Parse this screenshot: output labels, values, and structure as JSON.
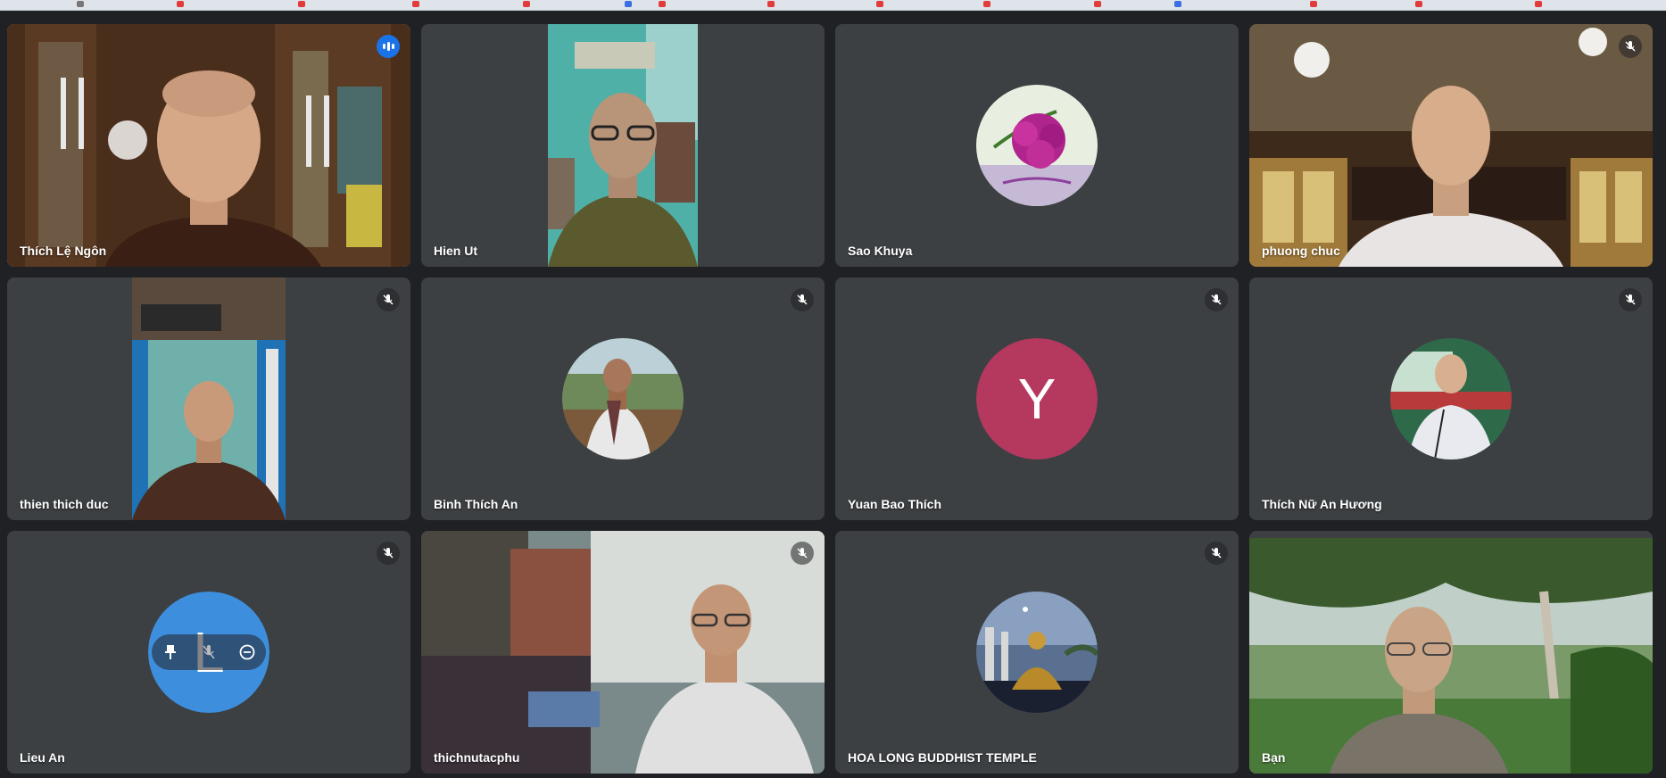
{
  "meeting": {
    "participants": [
      {
        "name": "Thích Lệ Ngôn",
        "speaking": true,
        "muted": false
      },
      {
        "name": "Hien Ut",
        "muted": false
      },
      {
        "name": "Sao Khuya",
        "muted": false
      },
      {
        "name": "phuong chuc",
        "muted": true
      },
      {
        "name": "thien thich duc",
        "muted": true
      },
      {
        "name": "Binh Thích An",
        "muted": true
      },
      {
        "name": "Yuan Bao Thích",
        "muted": true,
        "avatar_letter": "Y"
      },
      {
        "name": "Thích Nữ An Hương",
        "muted": true
      },
      {
        "name": "Lieu An",
        "muted": true,
        "avatar_letter": "L"
      },
      {
        "name": "thichnutacphu",
        "muted": true
      },
      {
        "name": "HOA LONG BUDDHIST TEMPLE",
        "muted": true
      },
      {
        "name": "Bạn",
        "muted": false
      }
    ]
  },
  "colors": {
    "background": "#202124",
    "tile": "#3c4043",
    "active_border": "#8ab4f8",
    "speaking_badge": "#1a73e8",
    "avatar_y": "#b5385e",
    "avatar_l": "#3e8ede"
  },
  "icons": {
    "muted": "mic-off-icon",
    "speaking": "audio-level-icon",
    "pin": "pin-icon",
    "mute": "mute-icon",
    "remove": "remove-icon"
  }
}
